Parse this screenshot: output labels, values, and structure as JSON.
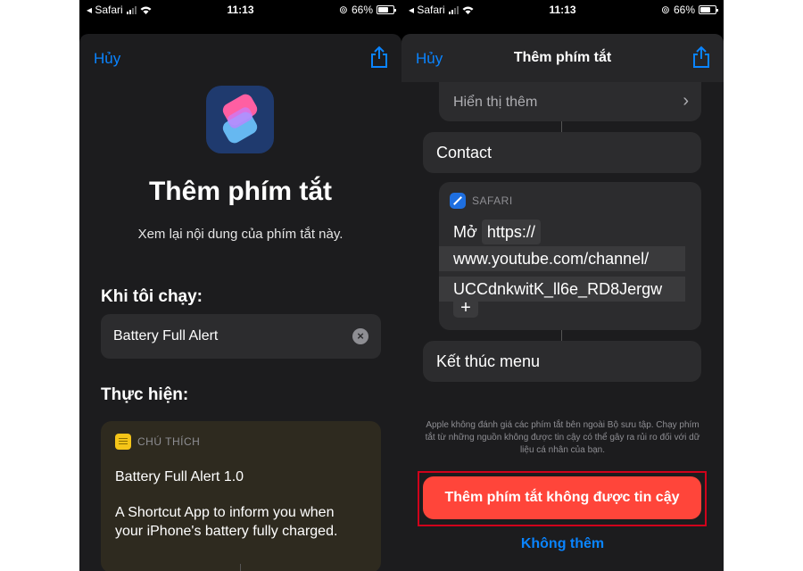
{
  "status": {
    "back_app": "Safari",
    "time": "11:13",
    "battery": "66%",
    "battery_level": 0.66
  },
  "left": {
    "cancel": "Hủy",
    "title": "Thêm phím tắt",
    "subtitle": "Xem lại nội dung của phím tắt này.",
    "when_run_label": "Khi tôi chạy:",
    "name_field_value": "Battery Full Alert",
    "perform_label": "Thực hiện:",
    "note": {
      "header": "CHÚ THÍCH",
      "title": "Battery Full Alert 1.0",
      "body_line1": "A Shortcut App to inform you when",
      "body_line2": "your iPhone's  battery fully charged."
    }
  },
  "right": {
    "cancel": "Hủy",
    "title": "Thêm phím tắt",
    "show_more": "Hiển thị thêm",
    "contact": "Contact",
    "safari_header": "SAFARI",
    "open_label": "Mở",
    "url_part1": "https://",
    "url_part2": "www.youtube.com/channel/",
    "url_part3": "UCCdnkwitK_ll6e_RD8Jergw",
    "plus": "+",
    "end_menu": "Kết thúc menu",
    "disclaimer": "Apple không đánh giá các phím tắt bên ngoài Bộ sưu tập. Chạy phím tắt từ những nguồn không được tin cậy có thể gây ra rủi ro đối với dữ liệu cá nhân của bạn.",
    "add_untrusted": "Thêm phím tắt không được tin cậy",
    "dont_add": "Không thêm"
  },
  "colors": {
    "accent": "#0a84ff",
    "danger": "#ff453a",
    "highlight_frame": "#d0021b"
  }
}
